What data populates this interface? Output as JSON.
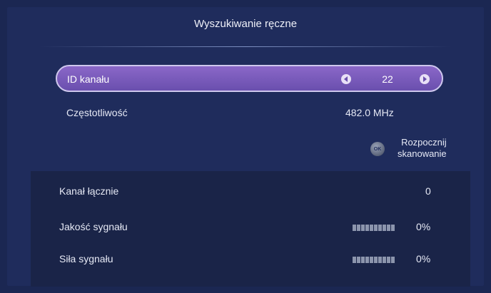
{
  "title": "Wyszukiwanie ręczne",
  "channel": {
    "label": "ID kanału",
    "value": "22"
  },
  "frequency": {
    "label": "Częstotliwość",
    "value": "482.0  MHz"
  },
  "scan": {
    "ok_text": "OK",
    "line1": "Rozpocznij",
    "line2": "skanowanie"
  },
  "info": {
    "total": {
      "label": "Kanał łącznie",
      "value": "0"
    },
    "quality": {
      "label": "Jakość sygnału",
      "value": "0%",
      "level": 0
    },
    "strength": {
      "label": "Siła sygnału",
      "value": "0%",
      "level": 0
    }
  },
  "colors": {
    "background": "#1b2752",
    "selected_row": "#7a5cbc",
    "info_box": "#1a2448"
  }
}
